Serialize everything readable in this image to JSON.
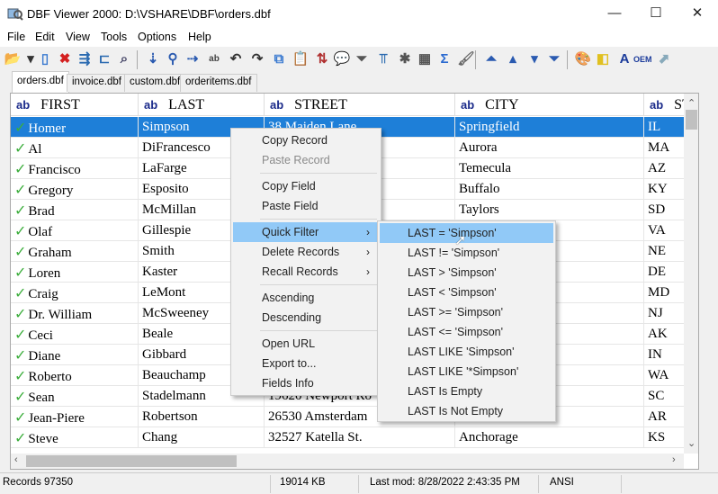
{
  "window": {
    "title": "DBF Viewer 2000: D:\\VSHARE\\DBF\\orders.dbf",
    "minimize": "—",
    "maximize": "☐",
    "close": "✕"
  },
  "menubar": [
    "File",
    "Edit",
    "View",
    "Tools",
    "Options",
    "Help"
  ],
  "toolbar": [
    {
      "name": "open-icon",
      "g": "📂",
      "c": "#d9a520"
    },
    {
      "name": "dropdown-icon",
      "g": "▾",
      "c": "#333"
    },
    {
      "name": "new-icon",
      "g": "▯",
      "c": "#3a7ad0"
    },
    {
      "name": "delete-icon",
      "g": "✖",
      "c": "#d42020"
    },
    {
      "name": "field-link-icon",
      "g": "⇶",
      "c": "#2a6ab0"
    },
    {
      "name": "structure-icon",
      "g": "⊏",
      "c": "#2a6ab0"
    },
    {
      "name": "find-icon",
      "g": "⌕",
      "c": "#446"
    },
    {
      "name": "goto-icon",
      "g": "⇣",
      "c": "#2a5ab0"
    },
    {
      "name": "search-icon",
      "g": "⚲",
      "c": "#2a5ab0"
    },
    {
      "name": "find-next-icon",
      "g": "⇢",
      "c": "#2a5ab0"
    },
    {
      "name": "replace-icon",
      "g": "ab",
      "c": "#444"
    },
    {
      "name": "undo-icon",
      "g": "↶",
      "c": "#333"
    },
    {
      "name": "redo-icon",
      "g": "↷",
      "c": "#333"
    },
    {
      "name": "copy-icon",
      "g": "⧉",
      "c": "#3a7ad0"
    },
    {
      "name": "paste-icon",
      "g": "📋",
      "c": "#666"
    },
    {
      "name": "sort-icon",
      "g": "⇅",
      "c": "#b03030"
    },
    {
      "name": "comment-icon",
      "g": "💬",
      "c": "#2a9ae0"
    },
    {
      "name": "filter-icon",
      "g": "⏷",
      "c": "#555"
    },
    {
      "name": "filter-field-icon",
      "g": "⫪",
      "c": "#2a6ab0"
    },
    {
      "name": "clear-filter-icon",
      "g": "✱",
      "c": "#555"
    },
    {
      "name": "table-icon",
      "g": "▦",
      "c": "#555"
    },
    {
      "name": "sum-icon",
      "g": "Σ",
      "c": "#2a6ad0"
    },
    {
      "name": "clean-icon",
      "g": "🖌",
      "c": "#666"
    },
    {
      "name": "first-record-icon",
      "g": "⏶",
      "c": "#2a5ab0"
    },
    {
      "name": "prev-record-icon",
      "g": "▴",
      "c": "#2a5ab0"
    },
    {
      "name": "next-record-icon",
      "g": "▾",
      "c": "#2a5ab0"
    },
    {
      "name": "last-record-icon",
      "g": "⏷",
      "c": "#2a5ab0"
    },
    {
      "name": "colors-icon",
      "g": "🎨",
      "c": "#2a6ab0"
    },
    {
      "name": "highlight-icon",
      "g": "◧",
      "c": "#e0c020"
    },
    {
      "name": "font-icon",
      "g": "A",
      "c": "#1a3a9a"
    },
    {
      "name": "oem-icon",
      "g": "OEM",
      "c": "#1a3a9a"
    },
    {
      "name": "export-icon",
      "g": "⬈",
      "c": "#8ab"
    }
  ],
  "tabs": [
    "orders.dbf",
    "invoice.dbf",
    "custom.dbf",
    "orderitems.dbf"
  ],
  "grid": {
    "type_label": "ab",
    "columns": [
      "FIRST",
      "LAST",
      "STREET",
      "CITY",
      "ST"
    ],
    "rows": [
      [
        "Homer",
        "Simpson",
        "38 Maiden Lane",
        "Springfield",
        "IL"
      ],
      [
        "Al",
        "DiFrancesco",
        "nue",
        "Aurora",
        "MA"
      ],
      [
        "Francisco",
        "LaFarge",
        "ne",
        "Temecula",
        "AZ"
      ],
      [
        "Gregory",
        "Esposito",
        "",
        "Buffalo",
        "KY"
      ],
      [
        "Brad",
        "McMillan",
        "t.",
        "Taylors",
        "SD"
      ],
      [
        "Olaf",
        "Gillespie",
        "",
        "",
        "VA"
      ],
      [
        "Graham",
        "Smith",
        "",
        "",
        "NE"
      ],
      [
        "Loren",
        "Kaster",
        "",
        "",
        "DE"
      ],
      [
        "Craig",
        "LeMont",
        "",
        "",
        "MD"
      ],
      [
        "Dr. William",
        "McSweeney",
        "",
        "",
        "NJ"
      ],
      [
        "Ceci",
        "Beale",
        "",
        "",
        "AK"
      ],
      [
        "Diane",
        "Gibbard",
        "",
        "",
        "IN"
      ],
      [
        "Roberto",
        "Beauchamp",
        "",
        "",
        "WA"
      ],
      [
        "Sean",
        "Stadelmann",
        "19620 Newport Ro",
        "",
        "SC"
      ],
      [
        "Jean-Piere",
        "Robertson",
        "26530 Amsterdam",
        "",
        "AR"
      ],
      [
        "Steve",
        "Chang",
        "32527 Katella St.",
        "Anchorage",
        "KS"
      ]
    ]
  },
  "context_menu": {
    "items": [
      {
        "label": "Copy Record"
      },
      {
        "label": "Paste Record",
        "disabled": true
      },
      {
        "sep": true
      },
      {
        "label": "Copy Field"
      },
      {
        "label": "Paste Field"
      },
      {
        "sep": true
      },
      {
        "label": "Quick Filter",
        "sub": true,
        "highlighted": true
      },
      {
        "label": "Delete Records",
        "sub": true
      },
      {
        "label": "Recall Records",
        "sub": true
      },
      {
        "sep": true
      },
      {
        "label": "Ascending"
      },
      {
        "label": "Descending"
      },
      {
        "sep": true
      },
      {
        "label": "Open URL"
      },
      {
        "label": "Export to..."
      },
      {
        "label": "Fields Info"
      }
    ],
    "submenu": [
      "LAST = 'Simpson'",
      "LAST != 'Simpson'",
      "LAST > 'Simpson'",
      "LAST < 'Simpson'",
      "LAST >= 'Simpson'",
      "LAST <= 'Simpson'",
      "LAST LIKE 'Simpson'",
      "LAST LIKE '*Simpson'",
      "LAST Is Empty",
      "LAST Is Not Empty"
    ]
  },
  "status": {
    "records": "Records 97350",
    "size": "19014 KB",
    "modified": "Last mod: 8/28/2022 2:43:35 PM",
    "encoding": "ANSI"
  },
  "colors": {
    "selection": "#1e7fd8",
    "menu_highlight": "#91c9f7",
    "check": "#3cae3c"
  }
}
